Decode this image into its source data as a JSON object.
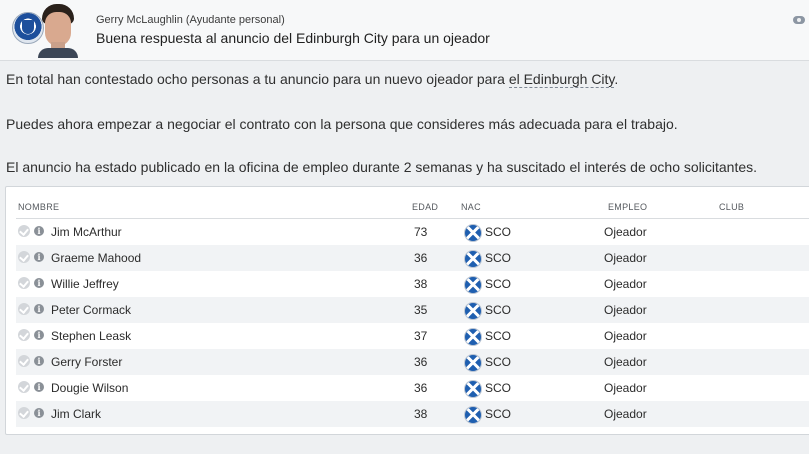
{
  "header": {
    "sender_name": "Gerry McLaughlin",
    "sender_role": "(Ayudante personal)",
    "subject": "Buena respuesta al anuncio del Edinburgh City para un ojeador"
  },
  "body": {
    "p1_before": "En total han contestado ocho personas a tu anuncio para un nuevo ojeador para ",
    "p1_link": "el Edinburgh City",
    "p1_after": ".",
    "p2": "Puedes ahora empezar a negociar el contrato con la persona que consideres más adecuada para el trabajo.",
    "p3": "El anuncio ha estado publicado en la oficina de empleo durante 2 semanas y ha suscitado el interés de ocho solicitantes."
  },
  "table": {
    "columns": {
      "name": "NOMBRE",
      "age": "EDAD",
      "nat": "NAC",
      "job": "EMPLEO",
      "club": "CLUB"
    },
    "rows": [
      {
        "name": "Jim McArthur",
        "age": "73",
        "nat": "SCO",
        "job": "Ojeador",
        "club": ""
      },
      {
        "name": "Graeme Mahood",
        "age": "36",
        "nat": "SCO",
        "job": "Ojeador",
        "club": ""
      },
      {
        "name": "Willie Jeffrey",
        "age": "38",
        "nat": "SCO",
        "job": "Ojeador",
        "club": ""
      },
      {
        "name": "Peter Cormack",
        "age": "35",
        "nat": "SCO",
        "job": "Ojeador",
        "club": ""
      },
      {
        "name": "Stephen Leask",
        "age": "37",
        "nat": "SCO",
        "job": "Ojeador",
        "club": ""
      },
      {
        "name": "Gerry Forster",
        "age": "36",
        "nat": "SCO",
        "job": "Ojeador",
        "club": ""
      },
      {
        "name": "Dougie Wilson",
        "age": "36",
        "nat": "SCO",
        "job": "Ojeador",
        "club": ""
      },
      {
        "name": "Jim Clark",
        "age": "38",
        "nat": "SCO",
        "job": "Ojeador",
        "club": ""
      }
    ]
  },
  "icons": {
    "club_badge": "club-badge-icon",
    "portrait": "staff-portrait",
    "row_check": "check-circle-icon",
    "row_info": "info-icon",
    "flag": "scotland-flag-icon"
  }
}
